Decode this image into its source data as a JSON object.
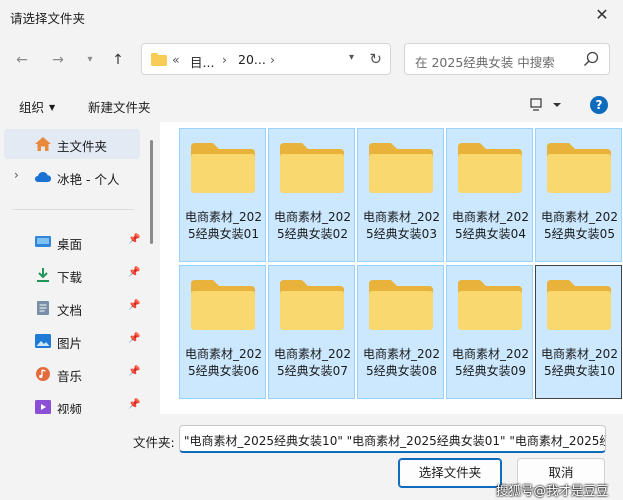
{
  "window": {
    "title": "请选择文件夹"
  },
  "nav": {
    "addr_prefix": "«",
    "crumbs": [
      "目...",
      "20..."
    ],
    "search_placeholder": "在 2025经典女装 中搜索"
  },
  "toolbar": {
    "organize": "组织",
    "new_folder": "新建文件夹",
    "help": "?"
  },
  "sidebar": {
    "items": [
      {
        "label": "主文件夹",
        "icon": "home-icon"
      },
      {
        "label": "冰艳 - 个人",
        "icon": "cloud-icon"
      },
      {
        "label": "桌面",
        "icon": "desktop-icon"
      },
      {
        "label": "下载",
        "icon": "download-icon"
      },
      {
        "label": "文档",
        "icon": "document-icon"
      },
      {
        "label": "图片",
        "icon": "pictures-icon"
      },
      {
        "label": "音乐",
        "icon": "music-icon"
      },
      {
        "label": "视频",
        "icon": "video-icon"
      }
    ]
  },
  "folders": [
    "电商素材_2025经典女装01",
    "电商素材_2025经典女装02",
    "电商素材_2025经典女装03",
    "电商素材_2025经典女装04",
    "电商素材_2025经典女装05",
    "电商素材_2025经典女装06",
    "电商素材_2025经典女装07",
    "电商素材_2025经典女装08",
    "电商素材_2025经典女装09",
    "电商素材_2025经典女装10"
  ],
  "footer": {
    "filename_label": "文件夹:",
    "filename_value": "\"电商素材_2025经典女装10\" \"电商素材_2025经典女装01\" \"电商素材_2025经",
    "select_button": "选择文件夹",
    "cancel_button": "取消"
  },
  "watermark": "搜狐号@我才是豆豆",
  "colors": {
    "accent": "#0f6cbd",
    "selection": "#cce8ff",
    "folder": "#f7cd55"
  }
}
